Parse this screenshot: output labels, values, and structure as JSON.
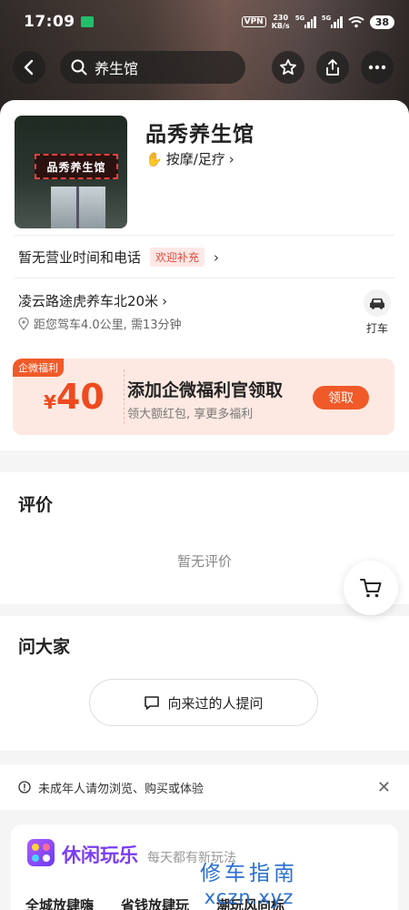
{
  "status_bar": {
    "time": "17:09",
    "vpn": "VPN",
    "speed_top": "230",
    "speed_unit": "KB/s",
    "sig1_tag": "5G",
    "sig2_tag": "5G",
    "battery": "38"
  },
  "nav": {
    "search_text": "养生馆",
    "icons": [
      "back-icon",
      "search-icon",
      "star-icon",
      "share-icon",
      "more-icon"
    ]
  },
  "shop": {
    "photo_sign": "品秀养生馆",
    "name": "品秀养生馆",
    "category": "按摩/足疗",
    "hours_text": "暂无营业时间和电话",
    "hours_tag": "欢迎补充",
    "address": "凌云路途虎养车北20米",
    "distance": "距您驾车4.0公里, 需13分钟",
    "taxi_label": "打车"
  },
  "promo": {
    "tag": "企微福利",
    "currency": "¥",
    "amount": "40",
    "title": "添加企微福利官领取",
    "subtitle": "领大额红包, 享更多福利",
    "button": "领取"
  },
  "reviews": {
    "title": "评价",
    "empty": "暂无评价"
  },
  "qa": {
    "title": "问大家",
    "ask_button": "向来过的人提问"
  },
  "notice": {
    "text": "未成年人请勿浏览、购买或体验"
  },
  "leisure": {
    "name": "休闲玩乐",
    "slogan": "每天都有新玩法",
    "items": [
      "全城放肆嗨",
      "省钱放肆玩",
      "潮玩风向标"
    ]
  },
  "watermark": {
    "line1": "修车指南",
    "line2": "xczn.xyz"
  },
  "colors": {
    "accent": "#f05a28",
    "promo_bg": "#fde9e2",
    "leisure_purple": "#7b3df2"
  }
}
